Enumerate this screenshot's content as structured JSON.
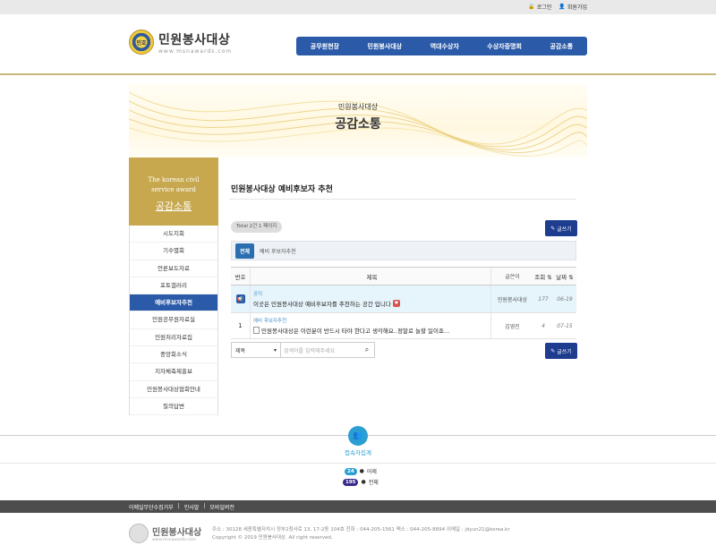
{
  "topbar": {
    "login": "로그인",
    "join": "회원가입"
  },
  "logo": {
    "title": "민원봉사대상",
    "url": "www.msnawards.com",
    "seal_text": "민호"
  },
  "gnb": [
    "공무원현장",
    "민원봉사대상",
    "역대수상자",
    "수상자증명회",
    "공감소통"
  ],
  "visual": {
    "subtitle": "민원봉사대상",
    "title": "공감소통"
  },
  "sidebar": {
    "head_en_1": "The korean civil",
    "head_en_2": "service award",
    "head_ko": "공감소통",
    "items": [
      "시도지회",
      "기수별회",
      "언론보도자료",
      "포토갤러리",
      "예비후보자추천",
      "민원공무원자료실",
      "민원처리자료집",
      "중앙회소식",
      "지자체축제홍보",
      "민원봉사대상협회안내",
      "질의답변"
    ],
    "active_index": 4
  },
  "board": {
    "title": "민원봉사대상 예비후보자 추천",
    "total": "Total 2건 1 페이지",
    "write_label": "글쓰기",
    "cat_all": "전체",
    "cat_name": "예비 후보자추천",
    "headers": {
      "num": "번호",
      "subject": "제목",
      "author": "글쓴이",
      "views": "조회",
      "date": "날짜"
    },
    "rows": [
      {
        "num": "",
        "tag": "공지",
        "subject": "이곳은 민원봉사대상 예비후보자를 추천하는 공간 입니다",
        "author": "민원봉사대상",
        "views": "177",
        "date": "06-19"
      },
      {
        "num": "1",
        "tag": "예비 후보자추천",
        "subject": "민원봉사대상은 이런분이 반드시 타야 한다고 생각해요..정말로 놀할 일이죠...",
        "author": "김영진",
        "views": "4",
        "date": "07-15"
      }
    ],
    "search_field": "제목",
    "search_placeholder": "검색어를 입력해주세요"
  },
  "visitor": {
    "title": "접속자집계",
    "yesterday_count": "24",
    "yesterday_label": "어제",
    "total_count": "195",
    "total_label": "전체"
  },
  "footer": {
    "links": [
      "이메일무단수집거부",
      "|",
      "인사말",
      "|",
      "모바일버전"
    ],
    "brand": "민원봉사대상",
    "brand_url": "www.msnawards.com",
    "address": "주소 : 30128 세종특별자치시 정부2청사로 13, 17-2동 104호   전화 : 044-205-1561   팩스 : 044-205-8894   이메일 : jdyun21@korea.kr",
    "copyright": "Copyright © 2019 민원봉사대상. All right reserved."
  }
}
